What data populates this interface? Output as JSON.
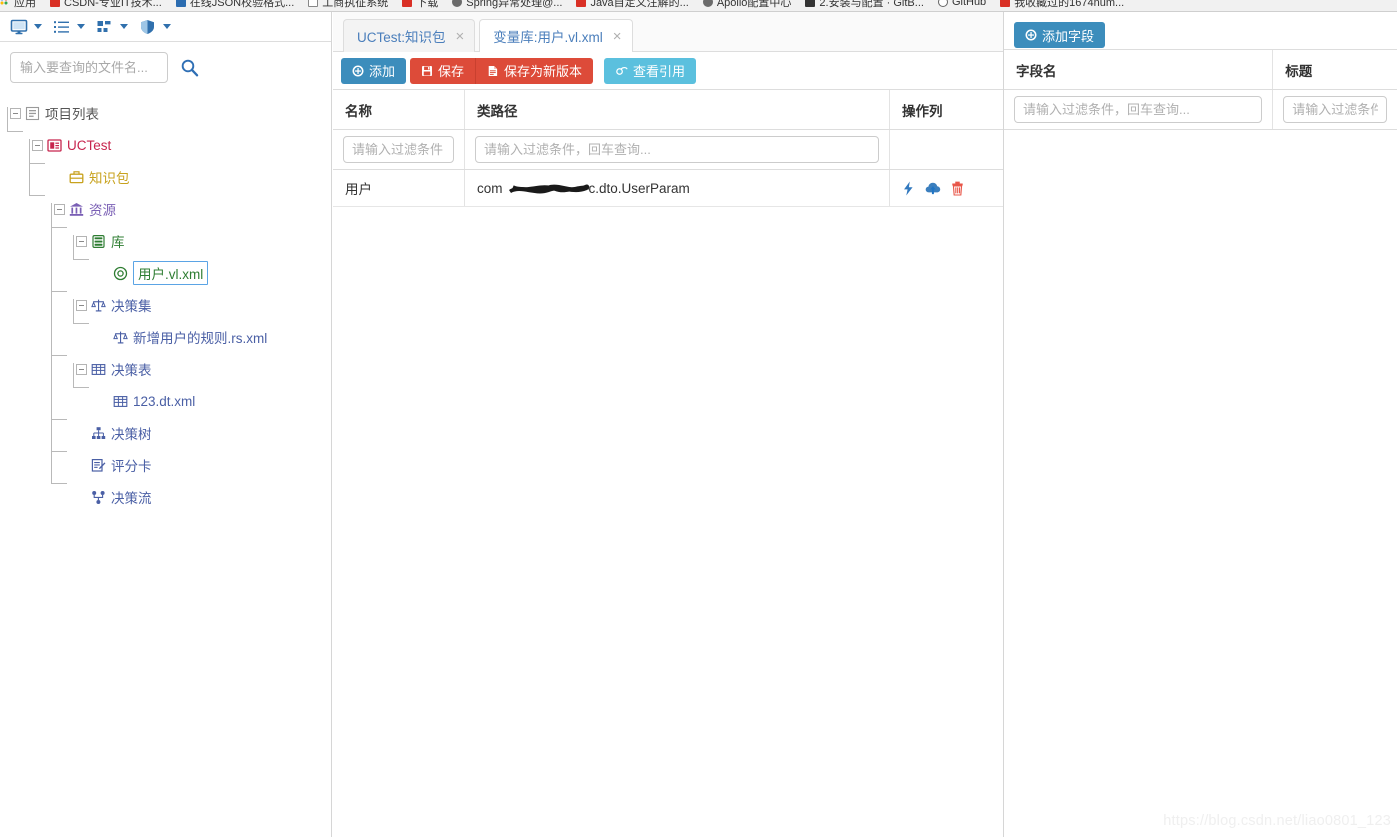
{
  "browser": {
    "bookmarks": [
      {
        "label": "应用",
        "icon": "dots-icon"
      },
      {
        "label": "CSDN-专业IT技术...",
        "icon": "csdn-icon"
      },
      {
        "label": "在线JSON校验格式...",
        "icon": "blue-icon"
      },
      {
        "label": "工商执征系统",
        "icon": "square-icon"
      },
      {
        "label": "下载",
        "icon": "csdn-icon"
      },
      {
        "label": "Spring异常处理@...",
        "icon": "gray-icon"
      },
      {
        "label": "Java自定义注解的...",
        "icon": "csdn-icon"
      },
      {
        "label": "Apollo配置中心",
        "icon": "gray-icon"
      },
      {
        "label": "2.安装与配置 · GitB...",
        "icon": "dark-icon"
      },
      {
        "label": "GitHub",
        "icon": "ring-icon"
      },
      {
        "label": "我收藏过的1674num...",
        "icon": "csdn-icon"
      }
    ]
  },
  "sidebar": {
    "toolbar": [
      {
        "name": "monitor-icon",
        "label": "显示"
      },
      {
        "name": "list-icon",
        "label": "列表"
      },
      {
        "name": "grid-icon",
        "label": "视图"
      },
      {
        "name": "shield-icon",
        "label": "权限"
      }
    ],
    "search": {
      "placeholder": "输入要查询的文件名...",
      "value": "",
      "button": "search-icon"
    },
    "tree": [
      {
        "label": "项目列表",
        "icon": "project-list-icon",
        "level": 0,
        "color": "#555555",
        "expanded": true,
        "hasExpander": true,
        "selected": false
      },
      {
        "label": "UCTest",
        "icon": "project-icon",
        "level": 1,
        "color": "#c7254e",
        "expanded": true,
        "hasExpander": true,
        "selected": false
      },
      {
        "label": "知识包",
        "icon": "package-icon",
        "level": 2,
        "color": "#c8a21e",
        "expanded": false,
        "hasExpander": false,
        "selected": false
      },
      {
        "label": "资源",
        "icon": "bank-icon",
        "level": 2,
        "color": "#7a5fb5",
        "expanded": true,
        "hasExpander": true,
        "selected": false
      },
      {
        "label": "库",
        "icon": "library-icon",
        "level": 3,
        "color": "#2e7d32",
        "expanded": true,
        "hasExpander": true,
        "selected": false
      },
      {
        "label": "用户.vl.xml",
        "icon": "variable-icon",
        "level": 4,
        "color": "#2e7d32",
        "expanded": false,
        "hasExpander": false,
        "selected": true
      },
      {
        "label": "决策集",
        "icon": "ruleset-icon",
        "level": 3,
        "color": "#4a5fa5",
        "expanded": true,
        "hasExpander": true,
        "selected": false
      },
      {
        "label": "新增用户的规则.rs.xml",
        "icon": "ruleset-icon",
        "level": 4,
        "color": "#4a5fa5",
        "expanded": false,
        "hasExpander": false,
        "selected": false
      },
      {
        "label": "决策表",
        "icon": "decision-table-icon",
        "level": 3,
        "color": "#4a5fa5",
        "expanded": true,
        "hasExpander": true,
        "selected": false
      },
      {
        "label": "123.dt.xml",
        "icon": "decision-table-icon",
        "level": 4,
        "color": "#4a5fa5",
        "expanded": false,
        "hasExpander": false,
        "selected": false
      },
      {
        "label": "决策树",
        "icon": "decision-tree-icon",
        "level": 3,
        "color": "#4a5fa5",
        "expanded": false,
        "hasExpander": false,
        "selected": false
      },
      {
        "label": "评分卡",
        "icon": "scorecard-icon",
        "level": 3,
        "color": "#4a5fa5",
        "expanded": false,
        "hasExpander": false,
        "selected": false
      },
      {
        "label": "决策流",
        "icon": "decision-flow-icon",
        "level": 3,
        "color": "#4a5fa5",
        "expanded": false,
        "hasExpander": false,
        "selected": false
      }
    ]
  },
  "main": {
    "tabs": [
      {
        "label": "UCTest:知识包",
        "active": false,
        "close": "×"
      },
      {
        "label": "变量库:用户.vl.xml",
        "active": true,
        "close": "×"
      }
    ],
    "toolbar": {
      "add_label": "添加",
      "save_label": "保存",
      "save_as_new_label": "保存为新版本",
      "view_ref_label": "查看引用"
    },
    "grid": {
      "columns": [
        "名称",
        "类路径",
        "操作列"
      ],
      "filters": [
        {
          "placeholder": "请输入过滤条件",
          "value": ""
        },
        {
          "placeholder": "请输入过滤条件，回车查询...",
          "value": ""
        },
        {
          "placeholder": "",
          "value": ""
        }
      ],
      "rows": [
        {
          "名称": "用户",
          "类路径_prefix": "com",
          "类路径_suffix": "c.dto.UserParam",
          "actions": [
            "lightning-icon",
            "cloud-upload-icon",
            "delete-icon"
          ]
        }
      ]
    }
  },
  "right": {
    "toolbar": {
      "add_field_label": "添加字段"
    },
    "grid": {
      "columns": [
        "字段名",
        "标题"
      ],
      "filters": [
        {
          "placeholder": "请输入过滤条件，回车查询...",
          "value": ""
        },
        {
          "placeholder": "请输入过滤条件",
          "value": ""
        }
      ],
      "rows": []
    }
  },
  "watermark": "https://blog.csdn.net/liao0801_123",
  "colors": {
    "primary_blue": "#3c8dbc",
    "danger_red": "#dd4b39",
    "info_cyan": "#5bc0de",
    "tab_link": "#4a7ebb",
    "selection_border": "#5ba4e5"
  }
}
